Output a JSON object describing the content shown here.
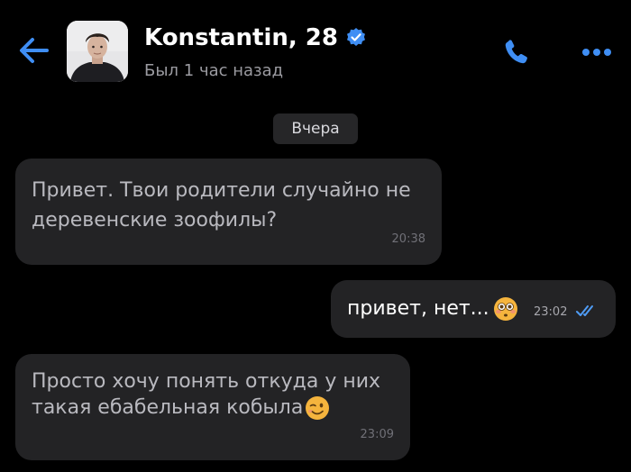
{
  "header": {
    "contact_name": "Konstantin, 28",
    "last_seen": "Был 1 час назад",
    "icons": {
      "back": "arrow-left-icon",
      "verified": "verified-badge-icon",
      "call": "phone-icon",
      "more": "more-dots-icon",
      "avatar": "person-photo"
    }
  },
  "chat": {
    "date_separator": "Вчера",
    "messages": [
      {
        "direction": "incoming",
        "line1": "Привет. Твои родители случайно не",
        "line2": "деревенские зоофилы?",
        "time": "20:38"
      },
      {
        "direction": "outgoing",
        "text": "привет, нет...",
        "emoji": "flushed-face-emoji",
        "time": "23:02",
        "status": "read-double-check"
      },
      {
        "direction": "incoming",
        "line1": "Просто хочу понять откуда у них",
        "line2": "такая ебабельная кобыла",
        "emoji": "winking-face-emoji",
        "time": "23:09"
      }
    ]
  },
  "colors": {
    "background": "#000000",
    "bubble": "#232325",
    "accent": "#3f8ef4",
    "muted_text": "#9b9ba1",
    "message_text": "#b9b9bf"
  }
}
